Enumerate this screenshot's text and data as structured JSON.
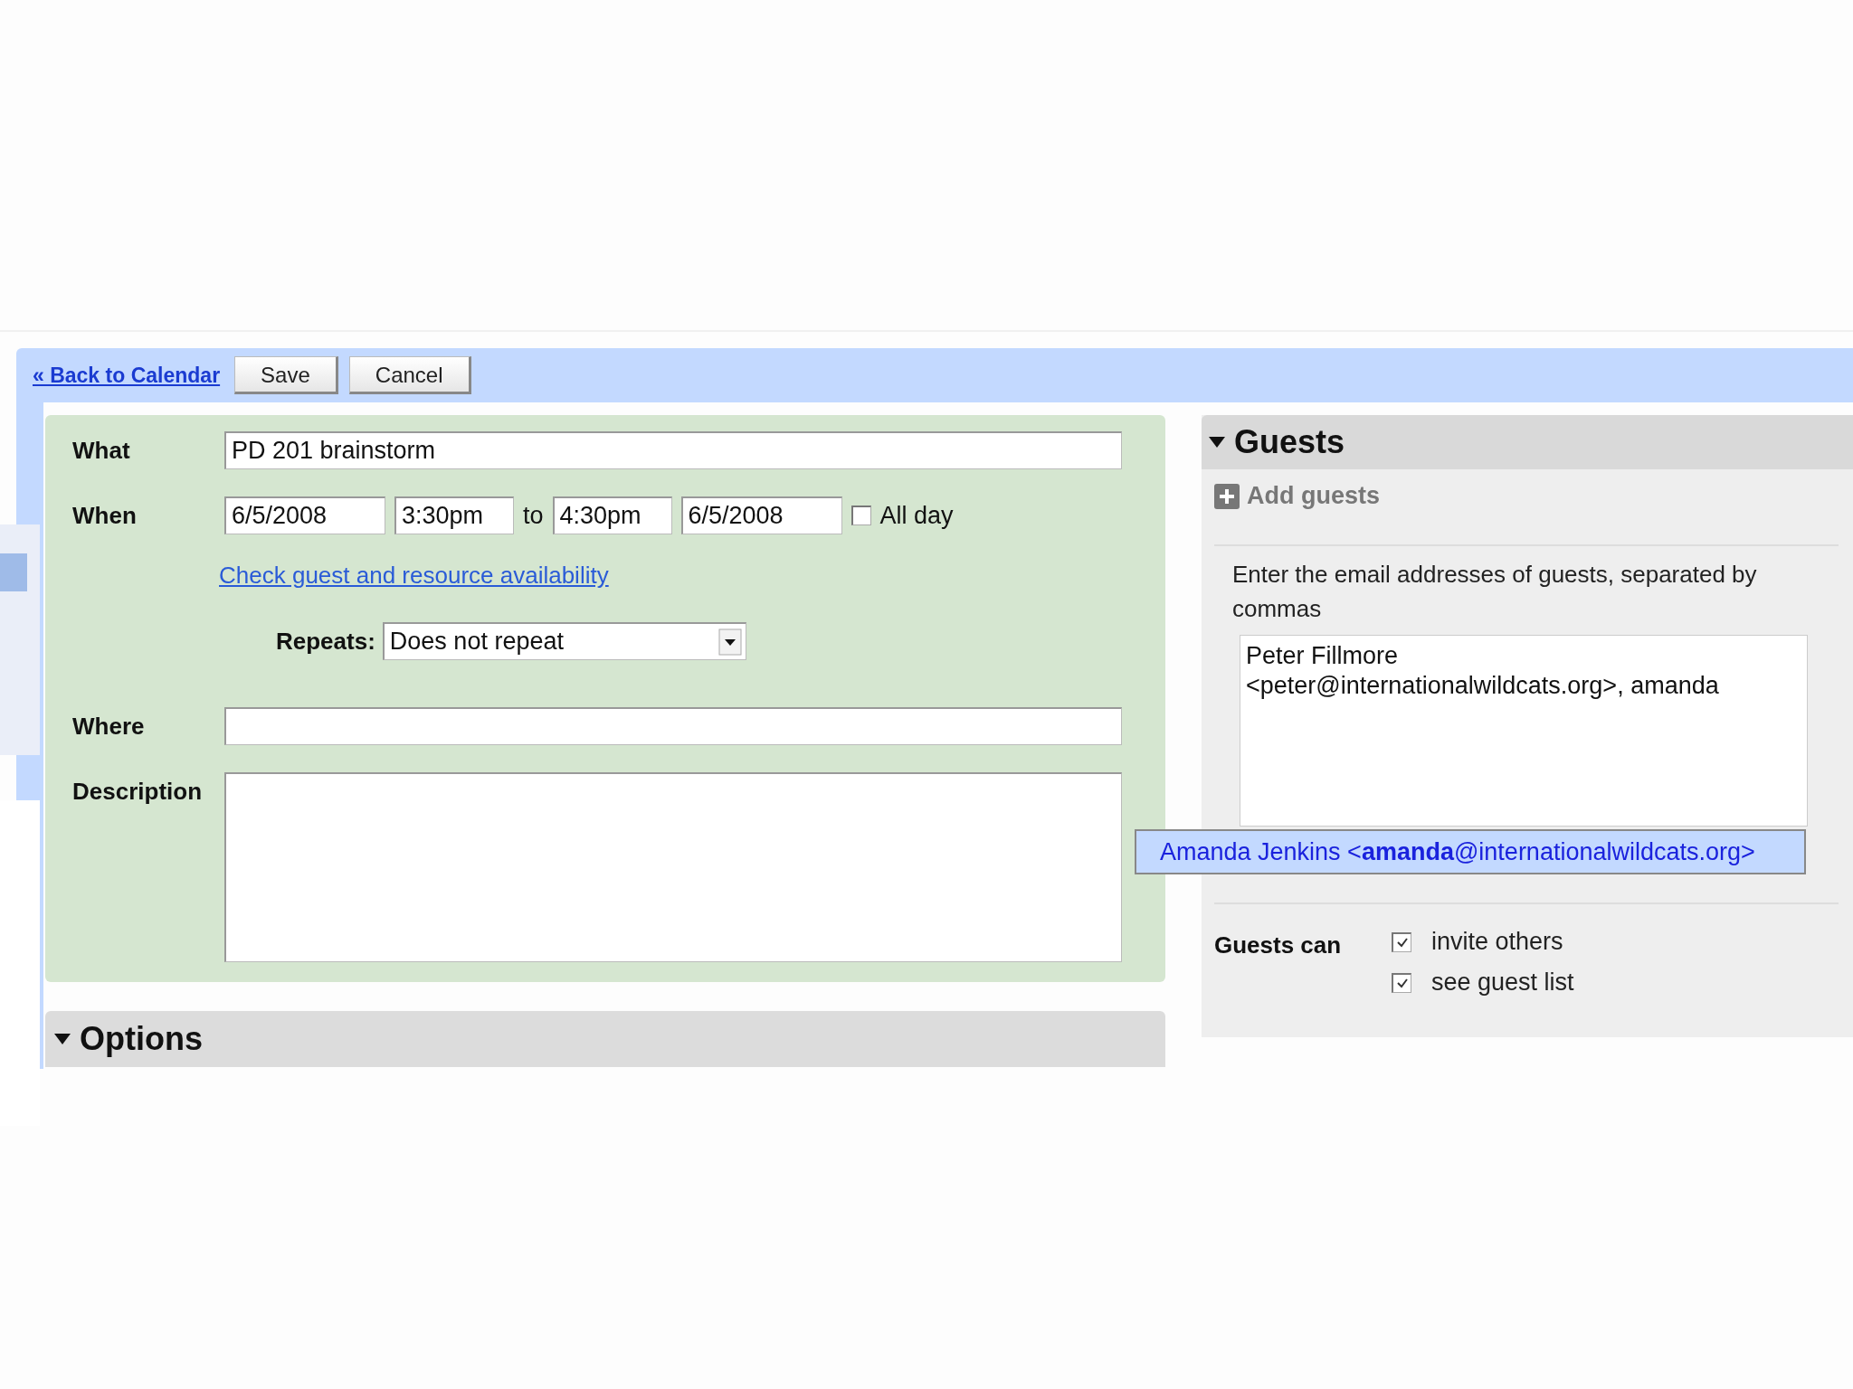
{
  "toolbar": {
    "back_link": "« Back to Calendar",
    "buttons": [
      {
        "label": "Save"
      },
      {
        "label": "Cancel"
      }
    ]
  },
  "form": {
    "what": {
      "label": "What",
      "value": "PD 201 brainstorm"
    },
    "when": {
      "label": "When",
      "start_date": "6/5/2008",
      "start_time": "3:30pm",
      "separator": "to",
      "end_time": "4:30pm",
      "end_date": "6/5/2008",
      "all_day": {
        "label": "All day",
        "checked": false
      }
    },
    "availability_link": "Check guest and resource availability",
    "repeats": {
      "label": "Repeats:",
      "value": "Does not repeat"
    },
    "where": {
      "label": "Where"
    },
    "description": {
      "label": "Description"
    }
  },
  "options": {
    "title": "Options",
    "expanded": true
  },
  "guests": {
    "title": "Guests",
    "expanded": true,
    "add_guests": "Add guests",
    "instructions": "Enter the email addresses of guests, separated by commas",
    "value": "Peter Fillmore <peter@internationalwildcats.org>, amanda",
    "suggestion": "Amanda Jenkins <**amanda**@internationalwildcats.org>",
    "guests_can": {
      "label": "Guests can",
      "options": [
        {
          "label": "invite others",
          "checked": true
        },
        {
          "label": "see guest list",
          "checked": true
        }
      ]
    }
  }
}
